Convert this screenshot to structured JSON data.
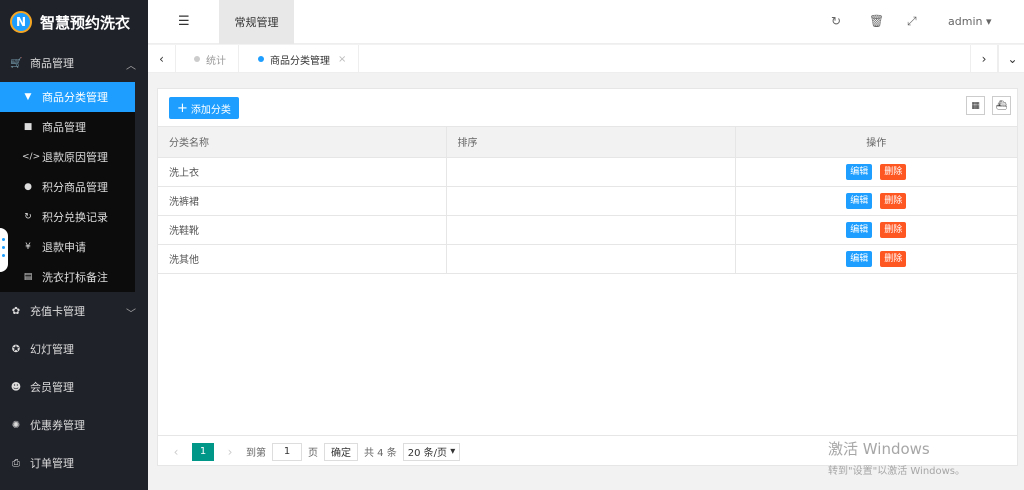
{
  "app": {
    "title": "智慧预约洗衣",
    "logo_mark": "N"
  },
  "sidebar": {
    "groups": [
      {
        "label": "商品管理",
        "icon": "cart-icon",
        "expanded": true,
        "items": [
          {
            "label": "商品分类管理",
            "icon": "filter-icon",
            "active": true
          },
          {
            "label": "商品管理",
            "icon": "briefcase-icon"
          },
          {
            "label": "退款原因管理",
            "icon": "code-icon"
          },
          {
            "label": "积分商品管理",
            "icon": "coin-icon"
          },
          {
            "label": "积分兑换记录",
            "icon": "refresh-icon"
          },
          {
            "label": "退款申请",
            "icon": "yen-icon"
          },
          {
            "label": "洗衣打标备注",
            "icon": "document-icon"
          }
        ]
      },
      {
        "label": "充值卡管理",
        "icon": "gift-icon"
      },
      {
        "label": "幻灯管理",
        "icon": "star-icon"
      },
      {
        "label": "会员管理",
        "icon": "cat-icon"
      },
      {
        "label": "优惠券管理",
        "icon": "rebel-icon"
      },
      {
        "label": "订单管理",
        "icon": "printer-icon"
      }
    ]
  },
  "header": {
    "menu_tab": "常规管理",
    "user": "admin"
  },
  "tabs": [
    {
      "label": "统计",
      "active": false
    },
    {
      "label": "商品分类管理",
      "active": true,
      "close": "×"
    }
  ],
  "toolbar": {
    "add_label": "添加分类"
  },
  "table": {
    "columns": [
      "分类名称",
      "排序",
      "操作"
    ],
    "rows": [
      {
        "name": "洗上衣",
        "sort": ""
      },
      {
        "name": "洗裤裙",
        "sort": ""
      },
      {
        "name": "洗鞋靴",
        "sort": ""
      },
      {
        "name": "洗其他",
        "sort": ""
      }
    ],
    "edit_label": "编辑",
    "delete_label": "删除"
  },
  "pager": {
    "current": "1",
    "goto_label": "到第",
    "goto_value": "1",
    "page_unit": "页",
    "confirm_label": "确定",
    "total_label": "共 4 条",
    "page_size": "20 条/页"
  },
  "watermark": {
    "line1": "激活 Windows",
    "line2": "转到\"设置\"以激活 Windows。"
  },
  "colors": {
    "accent": "#1e9fff",
    "danger": "#ff5722",
    "pager_active": "#009688",
    "sidebar_bg": "#20222a"
  }
}
